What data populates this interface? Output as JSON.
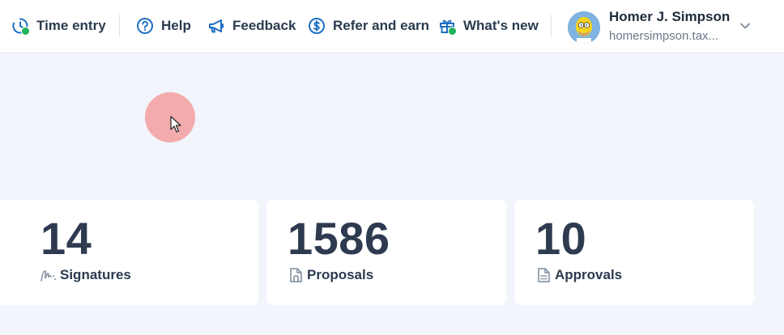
{
  "header": {
    "nav": [
      {
        "label": "Time entry",
        "icon": "clock-icon"
      },
      {
        "label": "Help",
        "icon": "question-circle-icon"
      },
      {
        "label": "Feedback",
        "icon": "megaphone-icon"
      },
      {
        "label": "Refer and earn",
        "icon": "dollar-circle-icon"
      },
      {
        "label": "What's new",
        "icon": "gift-icon"
      }
    ],
    "user": {
      "name": "Homer J. Simpson",
      "email": "homersimpson.tax..."
    }
  },
  "stats": [
    {
      "value": "14",
      "label": "Signatures",
      "icon": "signature-icon"
    },
    {
      "value": "1586",
      "label": "Proposals",
      "icon": "proposal-doc-icon"
    },
    {
      "value": "10",
      "label": "Approvals",
      "icon": "approval-doc-icon"
    }
  ],
  "colors": {
    "accent": "#1f6fc5",
    "status_dot": "#22b35a",
    "background": "#f2f5fb",
    "card": "#ffffff",
    "text": "#2b3a4f"
  }
}
